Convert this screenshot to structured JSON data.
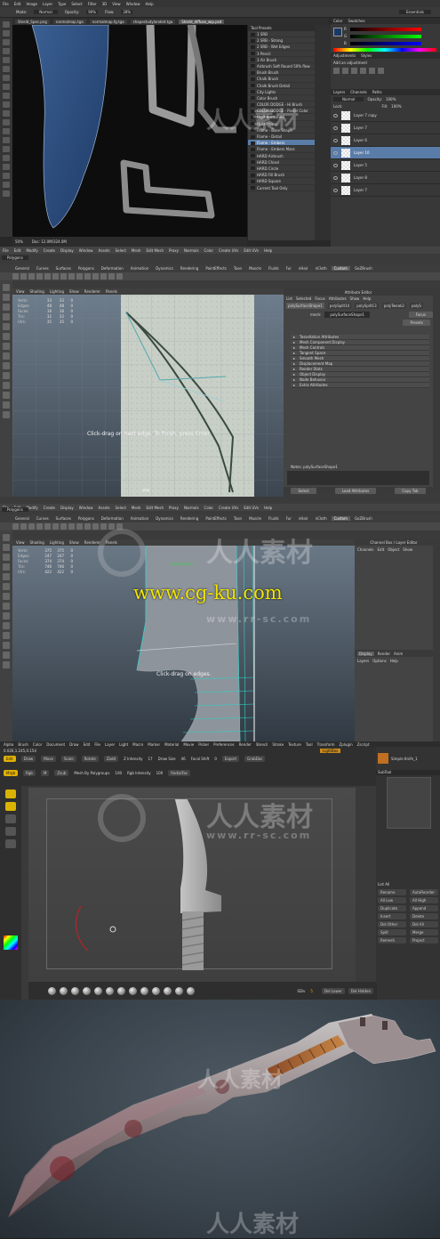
{
  "photoshop": {
    "menu": [
      "File",
      "Edit",
      "Image",
      "Layer",
      "Type",
      "Select",
      "Filter",
      "3D",
      "View",
      "Window",
      "Help"
    ],
    "options": {
      "mode_label": "Mode:",
      "mode_value": "Normal",
      "opacity_label": "Opacity:",
      "opacity_value": "90%",
      "flow_label": "Flow:",
      "flow_value": "28%"
    },
    "workspace": "Essentials",
    "doc_tabs": [
      "Shield_Spec.png",
      "normalmap.tga",
      "normalmap.fg.tga",
      "shapestudylanded.tga",
      "Shield_diffuse_wip.psd"
    ],
    "active_tab_index": 4,
    "status": {
      "zoom": "50%",
      "doc": "Doc: 12.0M/324.0M"
    },
    "brush_presets": {
      "title": "Tool Presets",
      "items": [
        "1 SRB",
        "2 SRB - Strong",
        "2 SRB - Wet Edges",
        "3 Pencil",
        "3 Air Brush",
        "Airbrush Soft Round 50% flow",
        "Brush Brush",
        "Chalk Brush",
        "Chalk Brush Detail",
        "City Lights",
        "Color Brush",
        "COLOR DODGE - Hi Brush",
        "COLOR DODGE - Pastel Color",
        "Digit Burnished",
        "Dust Flying",
        "Flame - Base Shape",
        "Flame - Detail",
        "Flame - Embers",
        "Flame - Embers Mass",
        "HARD Airbrush",
        "HARD Chisel",
        "HARD Circle",
        "HARD Fill Brush",
        "HARD Square",
        "Current Tool Only"
      ],
      "selected_index": 17
    },
    "color_panel": {
      "tabs": [
        "Color",
        "Swatches"
      ],
      "channels": [
        "R",
        "G",
        "B"
      ]
    },
    "adjustments": {
      "tabs": [
        "Adjustments",
        "Styles"
      ],
      "label": "Add an adjustment"
    },
    "layers": {
      "tabs": [
        "Layers",
        "Channels",
        "Paths"
      ],
      "blend": "Normal",
      "opacity_label": "Opacity:",
      "opacity": "100%",
      "lock_label": "Lock:",
      "fill_label": "Fill:",
      "fill": "100%",
      "items": [
        "Layer 7 copy",
        "Layer 7",
        "Layer 6",
        "Layer 10",
        "Layer 5",
        "Layer 8",
        "Layer 7"
      ],
      "selected_index": 3
    }
  },
  "maya1": {
    "menu": [
      "File",
      "Edit",
      "Modify",
      "Create",
      "Display",
      "Window",
      "Assets",
      "Select",
      "Mesh",
      "Edit Mesh",
      "Proxy",
      "Normals",
      "Color",
      "Create UVs",
      "Edit UVs",
      "Help"
    ],
    "mode": "Polygons",
    "shelf_tabs": [
      "General",
      "Curves",
      "Surfaces",
      "Polygons",
      "Deformation",
      "Animation",
      "Dynamics",
      "Rendering",
      "PaintEffects",
      "Toon",
      "Muscle",
      "Fluids",
      "Fur",
      "nHair",
      "nCloth",
      "Custom",
      "GoZBrush"
    ],
    "active_shelf_index": 15,
    "panel_menu": [
      "View",
      "Shading",
      "Lighting",
      "Show",
      "Renderer",
      "Panels"
    ],
    "hud": {
      "rows": [
        {
          "label": "Verts:",
          "a": "33",
          "b": "33",
          "c": "0"
        },
        {
          "label": "Edges:",
          "a": "48",
          "b": "48",
          "c": "0"
        },
        {
          "label": "Faces:",
          "a": "16",
          "b": "16",
          "c": "0"
        },
        {
          "label": "Tris:",
          "a": "32",
          "b": "32",
          "c": "0"
        },
        {
          "label": "UVs:",
          "a": "35",
          "b": "35",
          "c": "0"
        }
      ]
    },
    "hint": "Click-drag on next edge. To finish, press Enter",
    "camera_label": "side",
    "attribute_editor": {
      "title": "Attribute Editor",
      "menu": [
        "List",
        "Selected",
        "Focus",
        "Attributes",
        "Show",
        "Help"
      ],
      "tabs": [
        "polySurfaceShape1",
        "polySplit14",
        "polySplit13",
        "polyTweak2",
        "polyS"
      ],
      "mesh_label": "mesh:",
      "mesh_value": "polySurfaceShape1",
      "buttons_right": [
        "Focus",
        "Presets"
      ],
      "sections": [
        "Tessellation Attributes",
        "Mesh Component Display",
        "Mesh Controls",
        "Tangent Space",
        "Smooth Mesh",
        "Displacement Map",
        "Render Stats",
        "Object Display",
        "Node Behavior",
        "Extra Attributes"
      ],
      "notes_label": "Notes: polySurfaceShape1",
      "bottom_buttons": [
        "Select",
        "Load Attributes",
        "Copy Tab"
      ]
    }
  },
  "maya2": {
    "menu": [
      "File",
      "Edit",
      "Modify",
      "Create",
      "Display",
      "Window",
      "Assets",
      "Select",
      "Mesh",
      "Edit Mesh",
      "Proxy",
      "Normals",
      "Color",
      "Create UVs",
      "Edit UVs",
      "Help"
    ],
    "mode": "Polygons",
    "shelf_tabs": [
      "General",
      "Curves",
      "Surfaces",
      "Polygons",
      "Deformation",
      "Animation",
      "Dynamics",
      "Rendering",
      "PaintEffects",
      "Toon",
      "Muscle",
      "Fluids",
      "Fur",
      "nHair",
      "nCloth",
      "Custom",
      "GoZBrush"
    ],
    "active_shelf_index": 15,
    "panel_menu": [
      "View",
      "Shading",
      "Lighting",
      "Show",
      "Renderer",
      "Panels"
    ],
    "hud": {
      "rows": [
        {
          "label": "Verts:",
          "a": "375",
          "b": "375",
          "c": "0"
        },
        {
          "label": "Edges:",
          "a": "247",
          "b": "247",
          "c": "0"
        },
        {
          "label": "Faces:",
          "a": "374",
          "b": "374",
          "c": "0"
        },
        {
          "label": "Tris:",
          "a": "746",
          "b": "746",
          "c": "0"
        },
        {
          "label": "UVs:",
          "a": "422",
          "b": "422",
          "c": "0"
        }
      ]
    },
    "quality": "High Quality",
    "hint": "Click-drag on edges.",
    "channel_box": {
      "title": "Channel Box / Layer Editor",
      "menu": [
        "Channels",
        "Edit",
        "Object",
        "Show"
      ],
      "tabs": [
        "Display",
        "Render",
        "Anim"
      ],
      "layer_menu": [
        "Layers",
        "Options",
        "Help"
      ]
    },
    "side_tabs": [
      "Attribute Editor",
      "Channel Box / Layer Editor"
    ]
  },
  "zbrush": {
    "menu": [
      "Alpha",
      "Brush",
      "Color",
      "Document",
      "Draw",
      "Edit",
      "File",
      "Layer",
      "Light",
      "Macro",
      "Marker",
      "Material",
      "Movie",
      "Picker",
      "Preferences",
      "Render",
      "Stencil",
      "Stroke",
      "Texture",
      "Tool",
      "Transform",
      "Zplugin",
      "Zscript"
    ],
    "coords": "0.026,1.245,0.154",
    "shelf": {
      "buttons": [
        "Edit",
        "Draw",
        "Move",
        "Scale",
        "Rotate"
      ],
      "projection": "Light",
      "mode": [
        "Mrgb",
        "Rgb",
        "M"
      ],
      "zadd": "Zadd",
      "zsub": "Zsub",
      "intensity_label": "Z Intensity",
      "intensity": "17",
      "draw_size_label": "Draw Size",
      "draw_size": "46",
      "focal_label": "Focal Shift",
      "focal": "0",
      "export": "Export",
      "grabdoc": "GrabDoc",
      "mesh_label": "Mesh By Polygroups",
      "mesh_value": "100",
      "rgb_label": "Rgb Intensity",
      "rgb_value": "100",
      "radial": "RadialFac",
      "lightbox": "LightBox"
    },
    "right": {
      "tool_label": "Simple Knife_1",
      "subtool": "SubTool",
      "list_all": "List All",
      "buttons": [
        "Rename",
        "AutoReorder",
        "All Low",
        "All High",
        "Duplicate",
        "Append",
        "Insert",
        "Delete",
        "Del Other",
        "Del All",
        "Split",
        "Merge",
        "Remesh",
        "Project"
      ]
    },
    "bottom": {
      "brushes": [
        "Clay",
        "Move",
        "Standard",
        "Dam_St",
        "hPolish",
        "Pinch",
        "Inflat",
        "ClayBuildup",
        "TrimAdaptive",
        "TrimDynamic",
        "Flatten",
        "SnakeHook",
        "MaskPen"
      ],
      "sdiv_label": "SDiv",
      "sdiv": "5",
      "del_lower": "Del Lower",
      "del_hidden": "Del Hidden"
    }
  },
  "watermarks": {
    "brand": "人人素材",
    "url_main": "www.cg-ku.com",
    "url_sub": "www.rr-sc.com"
  },
  "colors": {
    "ps_selected": "#5a7ca8",
    "maya_teal": "#2fd1c8",
    "zbrush_yellow": "#e0b000",
    "watermark_yellow": "#f2e600"
  }
}
